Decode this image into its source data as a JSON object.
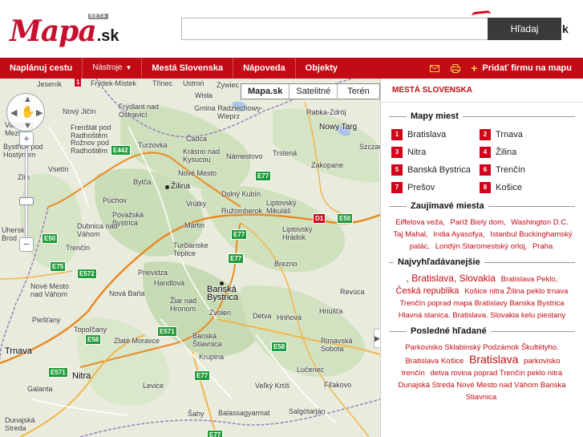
{
  "header": {
    "logo_main": "Mapa",
    "logo_suffix": ".sk",
    "beta": "BETA",
    "search_value": "",
    "search_button": "Hľadaj",
    "search_tail": "k"
  },
  "nav": {
    "items": [
      "Naplánuj cestu",
      "Nástroje",
      "Mestá Slovenska",
      "Nápoveda",
      "Objekty"
    ],
    "add_business": "Pridať firmu na mapu"
  },
  "map": {
    "map_types": [
      "Mapa.sk",
      "Satelitné",
      "Terén"
    ],
    "active_type": "Mapa.sk",
    "places": [
      "Frýdek-Místek",
      "Třinec",
      "Ustroń",
      "Zywiec",
      "Wisła",
      "Nový Jičín",
      "Frýdlant nad Ostravicí",
      "Gmina Radziechowy-Wieprz",
      "Valašské Meziříčí",
      "Frenštát pod Radhoštěm",
      "Rabka-Zdrój",
      "Rožnov pod Radhoštěm",
      "Turzovka",
      "Čadca",
      "Nowy Targ",
      "Szczaw",
      "Bystřice pod Hostýnem",
      "Vsetín",
      "Krásno nad Kysucou",
      "Námestovo",
      "Trstená",
      "Zakopane",
      "Nové Mesto",
      "Bytča",
      "Žilina",
      "Dolný Kubín",
      "Púchov",
      "Vrútky",
      "Ružomberok",
      "Liptovský Mikuláš",
      "Považská Bystrica",
      "Martin",
      "Liptovský Hrádok",
      "Dubnica nad Váhom",
      "Uherský Brod",
      "Trenčín",
      "Turčianske Teplice",
      "Brezno",
      "Prievidza",
      "Handlová",
      "Banská Bystrica",
      "Nové Mesto nad Váhom",
      "Nová Baňa",
      "Žiar nad Hronom",
      "Zvolen",
      "Detva",
      "Hriňová",
      "Revúca",
      "Piešťany",
      "Topoľčany",
      "Hnúšťa",
      "Zlaté Moravce",
      "Banská Štiavnica",
      "Rimavská Sobota",
      "Trnava",
      "Krupina",
      "Lučenec",
      "Nitra",
      "Levice",
      "Veľký Krtíš",
      "Fiľakovo",
      "Galanta",
      "Šahy",
      "Balassagyarmat",
      "Salgótarján",
      "Dunajská Streda",
      "Zlín",
      "Jeseník"
    ],
    "roads": [
      "E442",
      "E75",
      "E50",
      "E77",
      "E572",
      "E571",
      "E58",
      "D1",
      "E50"
    ],
    "marker_label": "1"
  },
  "sidebar": {
    "title": "MESTÁ SLOVENSKA",
    "city_maps_header": "Mapy miest",
    "cities": [
      {
        "num": "1",
        "name": "Bratislava"
      },
      {
        "num": "2",
        "name": "Trnava"
      },
      {
        "num": "3",
        "name": "Nitra"
      },
      {
        "num": "4",
        "name": "Žilina"
      },
      {
        "num": "5",
        "name": "Banská Bystrica"
      },
      {
        "num": "6",
        "name": "Trenčín"
      },
      {
        "num": "7",
        "name": "Prešov"
      },
      {
        "num": "8",
        "name": "Košice"
      }
    ],
    "interesting_header": "Zaujímavé miesta",
    "interesting": [
      "Eiffelova veža,",
      "Paríž Biely dom,",
      "Washington D.C.",
      "Taj Mahal,",
      "India Ayasofya,",
      "Istanbul Buckinghamský palác,",
      "Londýn Staromestský orloj,",
      "Praha"
    ],
    "popular_header": "Najvyhľadávanejšie",
    "popular": [
      {
        "t": ", Bratislava, Slovakia",
        "s": 2
      },
      {
        "t": "Bratislava Peklo,",
        "s": 1
      },
      {
        "t": "Česká republika",
        "s": 2
      },
      {
        "t": "Košice nitra Žilina peklo trnava",
        "s": 1
      },
      {
        "t": "Trenčín poprad mapa Bratislavy Banska Bystrica",
        "s": 1
      },
      {
        "t": "Hlavná stanica. Bratislava. Slovakia kelu piestany",
        "s": 1
      }
    ],
    "recent_header": "Posledné hľadané",
    "recent": [
      {
        "t": "Parkovisko Sklabinský Podzámok Škultétyho.",
        "s": 1
      },
      {
        "t": "Bratislava Košice",
        "s": 1
      },
      {
        "t": "Bratislava",
        "s": 3
      },
      {
        "t": "parkovisko trenčín",
        "s": 1
      },
      {
        "t": "detva rovina poprad Trenčín peklo nitra Dunajská Streda Nové Mesto nad Váhom Banska Stiavnica",
        "s": 1
      }
    ]
  }
}
